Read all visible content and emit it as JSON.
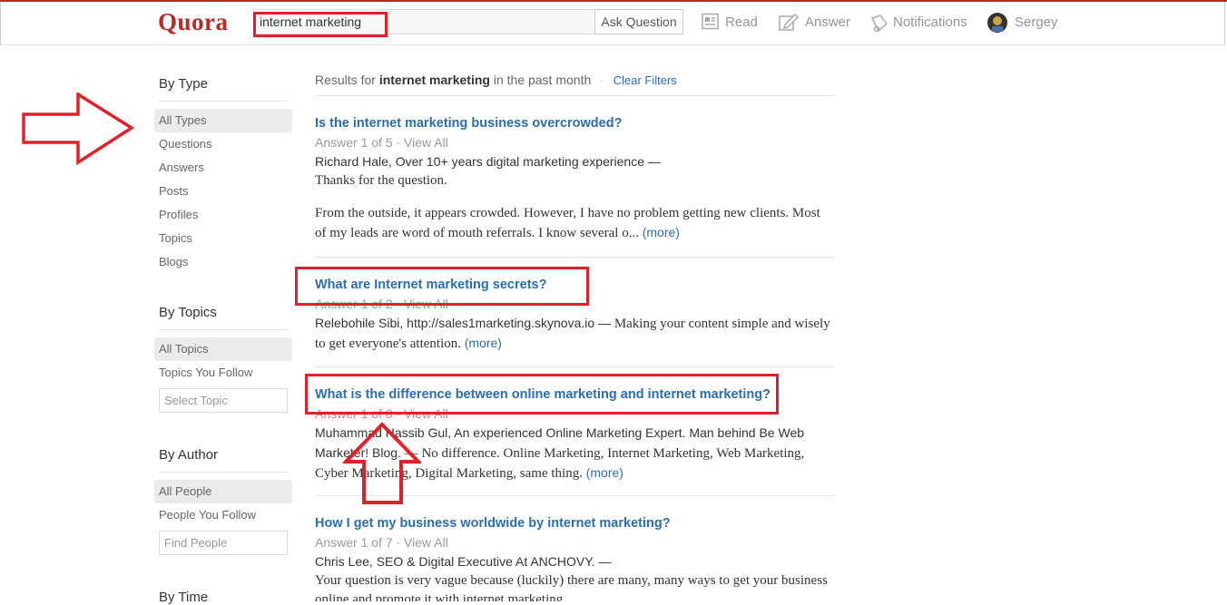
{
  "header": {
    "logo": "Quora",
    "search_value": "internet marketing",
    "ask_button": "Ask Question",
    "nav": {
      "read": "Read",
      "answer": "Answer",
      "notifications": "Notifications",
      "user": "Sergey"
    }
  },
  "sidebar": {
    "by_type": {
      "title": "By Type",
      "items": [
        "All Types",
        "Questions",
        "Answers",
        "Posts",
        "Profiles",
        "Topics",
        "Blogs"
      ]
    },
    "by_topics": {
      "title": "By Topics",
      "items": [
        "All Topics",
        "Topics You Follow"
      ],
      "input_placeholder": "Select Topic"
    },
    "by_author": {
      "title": "By Author",
      "items": [
        "All People",
        "People You Follow"
      ],
      "input_placeholder": "Find People"
    },
    "by_time": {
      "title": "By Time"
    }
  },
  "results": {
    "prefix": "Results for",
    "query": "internet marketing",
    "suffix": "in the past month",
    "separator": "·",
    "clear_filters": "Clear Filters",
    "items": [
      {
        "title": "Is the internet marketing business overcrowded?",
        "meta": "Answer 1 of 5 · View All",
        "author": "Richard Hale, Over 10+ years digital marketing experience —",
        "body_line1": "Thanks for the question.",
        "body_para2": "From the outside, it appears crowded. However, I have no problem getting new clients. Most of my leads are word of mouth referrals. I know several o...",
        "more": "(more)"
      },
      {
        "title": "What are Internet marketing secrets?",
        "meta": "Answer 1 of 2 · View All",
        "author": "Relebohile Sibi, http://sales1marketing.skynova.io —",
        "body": "Making your content simple and wisely to get everyone's attention.",
        "more": "(more)"
      },
      {
        "title": "What is the difference between online marketing and internet marketing?",
        "meta": "Answer 1 of 8 · View All",
        "author": "Muhammad Hassib Gul, An experienced Online Marketing Expert. Man behind Be Web Marketer! Blog.",
        "body": "— No difference. Online Marketing, Internet Marketing, Web Marketing, Cyber Marketing, Digital Marketing, same thing.",
        "more": "(more)"
      },
      {
        "title": "How I get my business worldwide by internet marketing?",
        "meta": "Answer 1 of 7 · View All",
        "author": "Chris Lee, SEO & Digital Executive At ANCHOVY. —",
        "body": "Your question is very vague because (luckily) there are many, many ways to get your business online and promote it with internet marketing..."
      }
    ]
  },
  "colors": {
    "brand": "#b92b27",
    "link": "#2b6dad",
    "annotation_red": "#e0202b"
  }
}
